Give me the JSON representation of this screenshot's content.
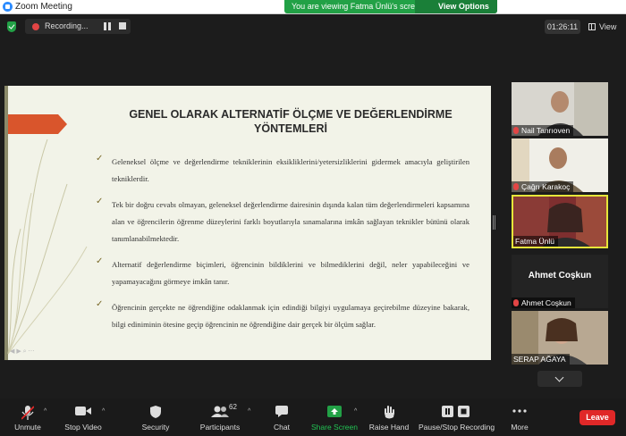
{
  "window": {
    "title": "Zoom Meeting"
  },
  "banner": {
    "viewing_text": "You are viewing Fatma Ünlü's screen",
    "view_options": "View Options"
  },
  "topbar": {
    "recording_label": "Recording...",
    "timer": "01:26:11",
    "view_label": "View"
  },
  "slide": {
    "title_line1": "GENEL OLARAK ALTERNATİF ÖLÇME VE DEĞERLENDİRME",
    "title_line2": "YÖNTEMLERİ",
    "bullets": [
      "Geleneksel ölçme ve değerlendirme tekniklerinin eksikliklerini/yetersizliklerini gidermek amacıyla geliştirilen tekniklerdir.",
      "Tek bir doğru cevabı olmayan, geleneksel değerlendirme dairesinin dışında kalan tüm değerlendirmeleri kapsamına alan ve öğrencilerin öğrenme düzeylerini farklı boyutlarıyla sınamalarına imkân sağlayan teknikler bütünü olarak tanımlanabilmektedir.",
      "Alternatif değerlendirme biçimleri, öğrencinin bildiklerini ve bilmediklerini değil, neler yapabileceğini ve yapamayacağını görmeye imkân tanır.",
      "Öğrencinin gerçekte ne öğrendiğine odaklanmak için edindiği bilgiyi uygulamaya geçirebilme düzeyine bakarak, bilgi ediniminin ötesine geçip öğrencinin ne öğrendiğine dair gerçek bir ölçüm sağlar."
    ]
  },
  "participants_panel": {
    "tiles": [
      {
        "name": "Nail Tanrıoven",
        "muted": true
      },
      {
        "name": "Çağrı Karakoç",
        "muted": true
      },
      {
        "name": "Fatma Ünlü",
        "muted": false,
        "active": true
      },
      {
        "name": "Ahmet Coşkun",
        "muted": true,
        "video_off": true
      },
      {
        "name": "SERAP AĞAYA",
        "muted": false
      }
    ]
  },
  "toolbar": {
    "unmute": "Unmute",
    "stop_video": "Stop Video",
    "security": "Security",
    "participants": "Participants",
    "participants_count": "62",
    "chat": "Chat",
    "share_screen": "Share Screen",
    "raise_hand": "Raise Hand",
    "pause_recording": "Pause/Stop Recording",
    "more": "More",
    "leave": "Leave"
  },
  "colors": {
    "accent_green": "#22a146",
    "leave_red": "#e02828",
    "slide_arrow": "#d9552c",
    "active_border": "#e6e63a"
  }
}
